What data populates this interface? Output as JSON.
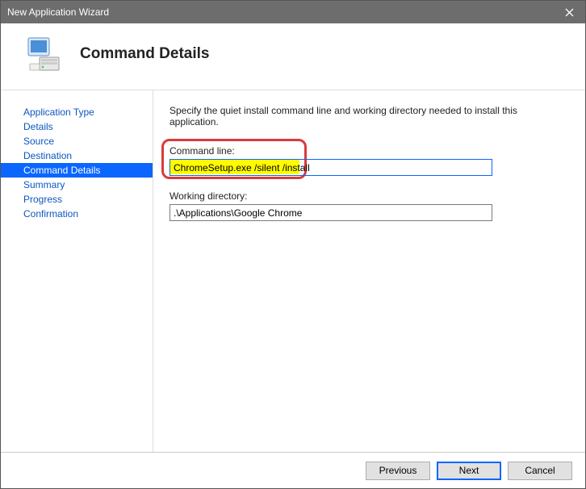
{
  "window": {
    "title": "New Application Wizard"
  },
  "header": {
    "title": "Command Details"
  },
  "sidebar": {
    "items": [
      {
        "label": "Application Type",
        "selected": false
      },
      {
        "label": "Details",
        "selected": false
      },
      {
        "label": "Source",
        "selected": false
      },
      {
        "label": "Destination",
        "selected": false
      },
      {
        "label": "Command Details",
        "selected": true
      },
      {
        "label": "Summary",
        "selected": false
      },
      {
        "label": "Progress",
        "selected": false
      },
      {
        "label": "Confirmation",
        "selected": false
      }
    ]
  },
  "content": {
    "instruction": "Specify the quiet install command line and working directory needed to install this application.",
    "command_line": {
      "label": "Command line:",
      "value": "ChromeSetup.exe /silent /install"
    },
    "working_directory": {
      "label": "Working directory:",
      "value": ".\\Applications\\Google Chrome"
    }
  },
  "footer": {
    "previous": "Previous",
    "next": "Next",
    "cancel": "Cancel"
  },
  "annotations": {
    "highlight_color": "#d93b3b",
    "text_highlight_color": "#fffb00"
  }
}
